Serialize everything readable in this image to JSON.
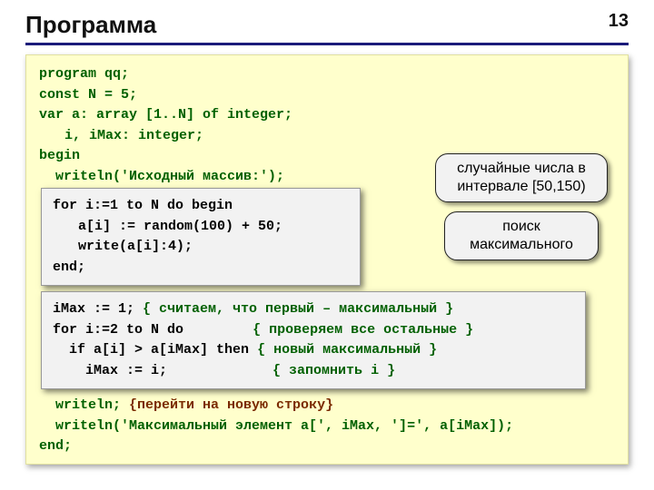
{
  "header": {
    "title": "Программа",
    "page_number": "13"
  },
  "code": {
    "l1": "program qq;",
    "l2": "const N = 5;",
    "l3": "var a: array [1..N] of integer;",
    "l4": "i, iMax: integer;",
    "l5": "begin",
    "l6": "writeln('Исходный массив:');",
    "l7": "writeln;",
    "l7_comment": "{перейти на новую строку}",
    "l8": "writeln('Максимальный элемент a[', iMax, ']=', a[iMax]);",
    "l9": "end;"
  },
  "callouts": {
    "random": "случайные числа в интервале [50,150)",
    "max": "поиск максимального"
  },
  "box_random": {
    "l1": "for i:=1 to N do begin",
    "l2": "a[i] := random(100) + 50;",
    "l3": "write(a[i]:4);",
    "l4": "end;"
  },
  "box_max": {
    "l1": "iMax := 1;",
    "l1_c": "{ считаем, что первый – максимальный }",
    "l2": "for i:=2 to N do",
    "l2_c": "{ проверяем все остальные }",
    "l3": "if a[i] > a[iMax] then",
    "l3_c": "{ новый максимальный }",
    "l4": "iMax := i;",
    "l4_c": "{ запомнить i }"
  }
}
